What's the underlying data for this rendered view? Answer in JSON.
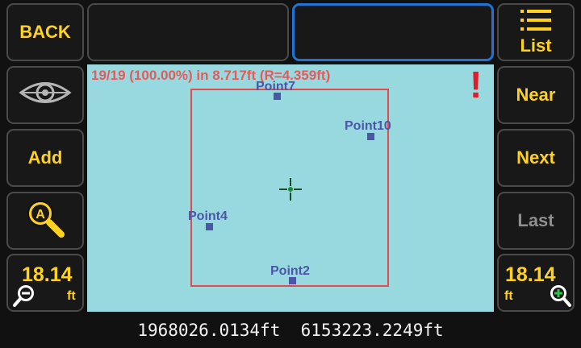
{
  "left_panel": {
    "back_label": "BACK",
    "add_label": "Add",
    "zoom_out_value": "18.14",
    "zoom_out_unit": "ft"
  },
  "right_panel": {
    "list_label": "List",
    "near_label": "Near",
    "next_label": "Next",
    "last_label": "Last",
    "zoom_in_value": "18.14",
    "zoom_in_unit": "ft"
  },
  "map": {
    "summary": "19/19 (100.00%) in 8.717ft (R=4.359ft)",
    "alert": "!",
    "points": [
      {
        "label": "Point7"
      },
      {
        "label": "Point10"
      },
      {
        "label": "Point4"
      },
      {
        "label": "Point2"
      }
    ]
  },
  "status_bar": {
    "easting": "1968026.0134ft",
    "northing": "6153223.2249ft"
  },
  "colors": {
    "accent_yellow": "#ffd21f",
    "map_background": "#98d8df",
    "alert_red": "#e11d2a",
    "point_blue": "#4a57a8",
    "active_border_blue": "#1f74d6"
  }
}
